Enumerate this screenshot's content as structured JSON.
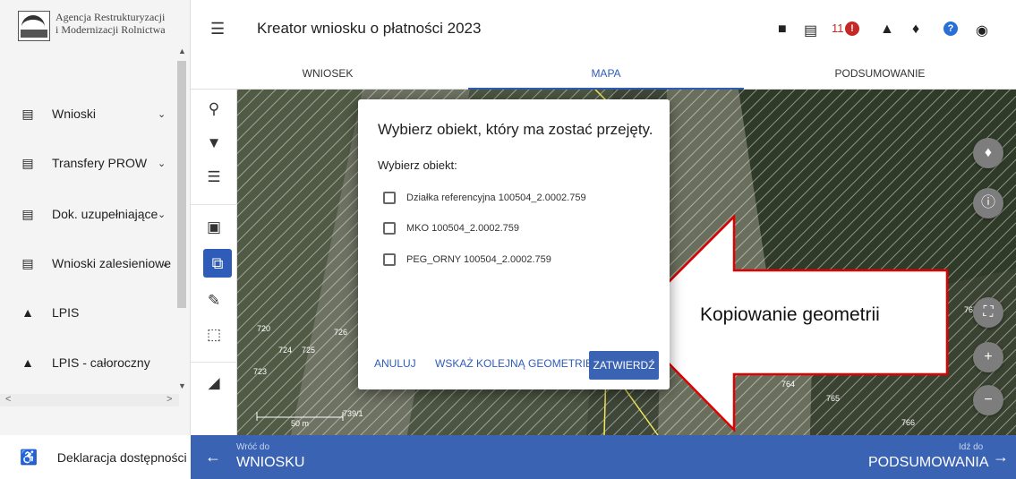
{
  "org": {
    "line1": "Agencja Restrukturyzacji",
    "line2": "i Modernizacji Rolnictwa",
    "logo_abbr": "ARiMR"
  },
  "header": {
    "title": "Kreator wniosku o płatności 2023",
    "alert_count": "11",
    "alert_icon": "!",
    "help_icon": "?"
  },
  "tabs": [
    {
      "label": "WNIOSEK"
    },
    {
      "label": "MAPA"
    },
    {
      "label": "PODSUMOWANIE"
    }
  ],
  "sidebar": {
    "items": [
      {
        "label": "Wnioski",
        "icon": "clipboard-icon"
      },
      {
        "label": "Transfery PROW",
        "icon": "clipboard-icon"
      },
      {
        "label": "Dok. uzupełniające",
        "icon": "clipboard-icon"
      },
      {
        "label": "Wnioski zalesieniowe",
        "icon": "clipboard-icon"
      },
      {
        "label": "LPIS",
        "icon": "terrain-icon"
      },
      {
        "label": "LPIS - całoroczny",
        "icon": "terrain-icon"
      }
    ],
    "footer": "Deklaracja dostępności"
  },
  "map": {
    "labels": [
      "720",
      "726",
      "724",
      "725",
      "723",
      "739/1",
      "767",
      "764",
      "765",
      "766"
    ],
    "scale": "50 m"
  },
  "dialog": {
    "title": "Wybierz obiekt, który ma zostać przejęty.",
    "subtitle": "Wybierz obiekt:",
    "options": [
      {
        "label": "Działka referencyjna 100504_2.0002.759",
        "checked": false
      },
      {
        "label": "MKO 100504_2.0002.759",
        "checked": false
      },
      {
        "label": "PEG_ORNY 100504_2.0002.759",
        "checked": false
      }
    ],
    "cancel": "ANULUJ",
    "next": "WSKAŻ KOLEJNĄ GEOMETRIĘ",
    "confirm": "ZATWIERDŹ"
  },
  "bottom": {
    "back_small": "Wróć do",
    "back_big": "WNIOSKU",
    "next_small": "Idź do",
    "next_big": "PODSUMOWANIA"
  },
  "callout": {
    "text": "Kopiowanie geometrii"
  },
  "colors": {
    "primary": "#3b63b4",
    "alert": "#c62828",
    "help": "#2970d6",
    "callout_border": "#e00000"
  }
}
